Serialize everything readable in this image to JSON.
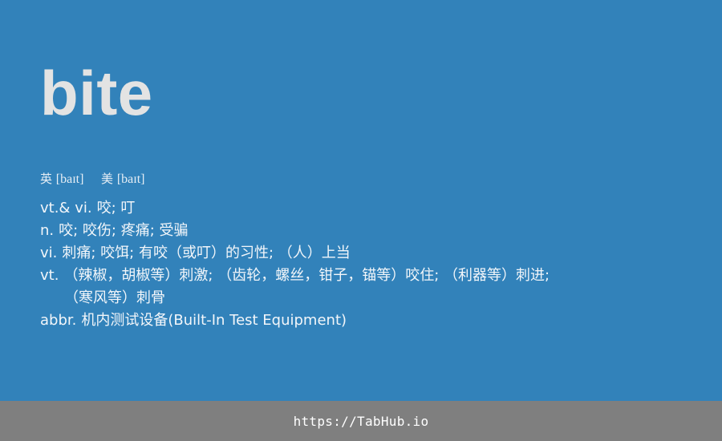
{
  "headword": "bite",
  "phonetics": {
    "uk_label": "英",
    "uk_ipa": "[baɪt]",
    "us_label": "美",
    "us_ipa": "[baɪt]"
  },
  "definitions": [
    {
      "pos": "vt.& vi.",
      "text": "咬; 叮"
    },
    {
      "pos": "n.",
      "text": "咬; 咬伤; 疼痛; 受骗"
    },
    {
      "pos": "vi.",
      "text": "刺痛; 咬饵; 有咬（或叮）的习性; （人）上当"
    },
    {
      "pos": "vt.",
      "text": "（辣椒，胡椒等）刺激; （齿轮，螺丝，钳子，锚等）咬住; （利器等）刺进;"
    },
    {
      "pos": "",
      "text": "（寒风等）刺骨"
    },
    {
      "pos": "abbr.",
      "text": "机内测试设备(Built-In Test Equipment)"
    }
  ],
  "footer": {
    "url": "https://TabHub.io"
  },
  "colors": {
    "background": "#3282ba",
    "footer_bg": "#7f7f7f",
    "headword": "#e3e3e3",
    "text": "#f2f6fa"
  }
}
